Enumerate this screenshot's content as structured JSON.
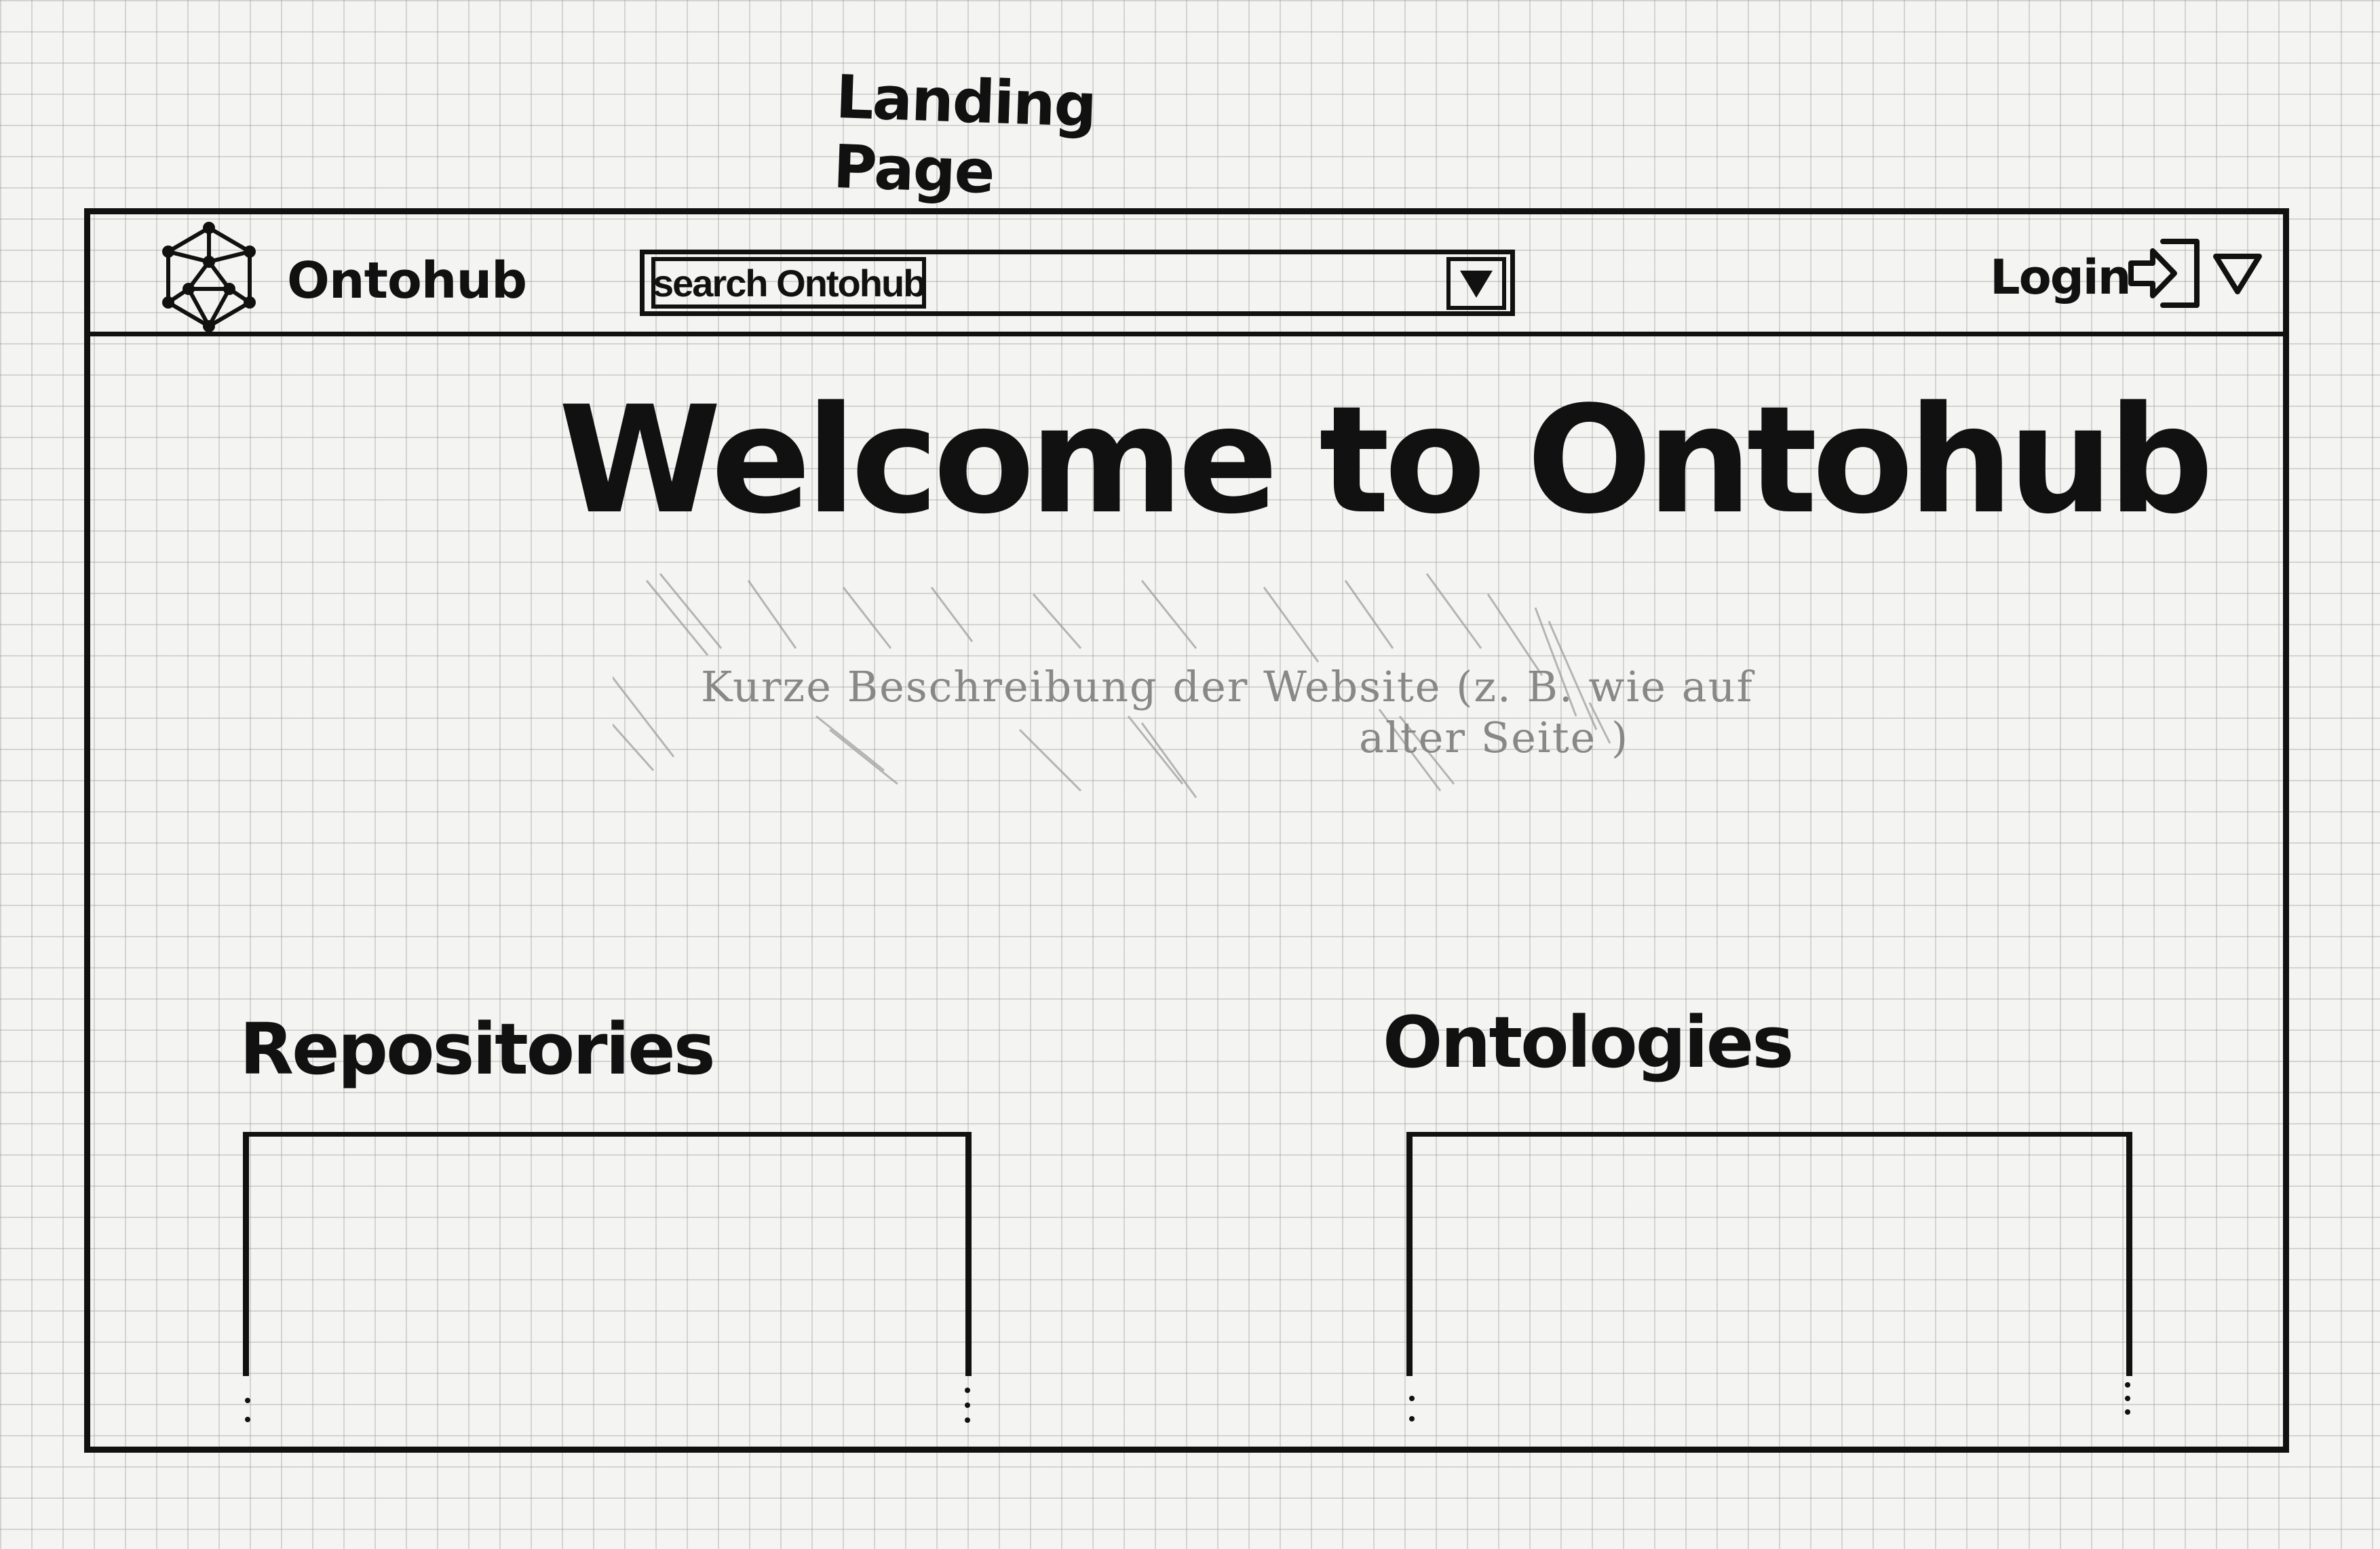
{
  "sheet": {
    "title": "Landing Page"
  },
  "navbar": {
    "brand": "Ontohub",
    "logo_icon": "ontology-graph-icon",
    "search": {
      "placeholder": "search Ontohub",
      "dropdown_icon": "triangle-down-icon"
    },
    "login_label": "Login",
    "login_icon": "login-arrow-icon",
    "menu_icon": "triangle-down-outline-icon"
  },
  "hero": {
    "title": "Welcome to Ontohub",
    "description_line1": "Kurze Beschreibung der Website (z. B. wie auf",
    "description_line2": "alter Seite )"
  },
  "sections": {
    "repositories": {
      "heading": "Repositories"
    },
    "ontologies": {
      "heading": "Ontologies"
    }
  },
  "colors": {
    "ink": "#111111",
    "pencil": "#888888",
    "paper": "#f4f4f2",
    "grid": "#969696"
  }
}
